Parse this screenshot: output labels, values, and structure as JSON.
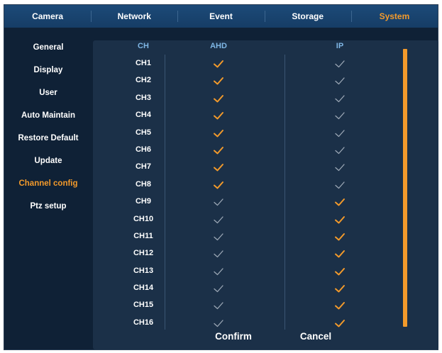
{
  "tabs": [
    "Camera",
    "Network",
    "Event",
    "Storage",
    "System"
  ],
  "active_tab": "System",
  "sidebar": [
    {
      "label": "General"
    },
    {
      "label": "Display"
    },
    {
      "label": "User"
    },
    {
      "label": "Auto Maintain"
    },
    {
      "label": "Restore Default"
    },
    {
      "label": "Update"
    },
    {
      "label": "Channel config"
    },
    {
      "label": "Ptz setup"
    }
  ],
  "active_sidebar": "Channel config",
  "table": {
    "headers": {
      "ch": "CH",
      "ahd": "AHD",
      "ip": "IP"
    },
    "rows": [
      {
        "ch": "CH1",
        "ahd": true,
        "ip": false
      },
      {
        "ch": "CH2",
        "ahd": true,
        "ip": false
      },
      {
        "ch": "CH3",
        "ahd": true,
        "ip": false
      },
      {
        "ch": "CH4",
        "ahd": true,
        "ip": false
      },
      {
        "ch": "CH5",
        "ahd": true,
        "ip": false
      },
      {
        "ch": "CH6",
        "ahd": true,
        "ip": false
      },
      {
        "ch": "CH7",
        "ahd": true,
        "ip": false
      },
      {
        "ch": "CH8",
        "ahd": true,
        "ip": false
      },
      {
        "ch": "CH9",
        "ahd": false,
        "ip": true
      },
      {
        "ch": "CH10",
        "ahd": false,
        "ip": true
      },
      {
        "ch": "CH11",
        "ahd": false,
        "ip": true
      },
      {
        "ch": "CH12",
        "ahd": false,
        "ip": true
      },
      {
        "ch": "CH13",
        "ahd": false,
        "ip": true
      },
      {
        "ch": "CH14",
        "ahd": false,
        "ip": true
      },
      {
        "ch": "CH15",
        "ahd": false,
        "ip": true
      },
      {
        "ch": "CH16",
        "ahd": false,
        "ip": true
      }
    ]
  },
  "buttons": {
    "confirm": "Confirm",
    "cancel": "Cancel"
  },
  "colors": {
    "accent": "#f39a2b",
    "check_off": "#9aa6b4",
    "header": "#7fb7e6"
  }
}
